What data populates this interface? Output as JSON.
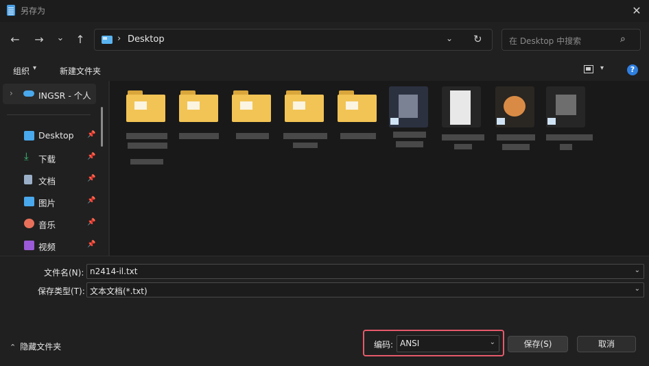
{
  "window": {
    "title": "另存为",
    "close_glyph": "✕"
  },
  "nav": {
    "back": "←",
    "forward": "→",
    "recent": "⌄",
    "up": "↑"
  },
  "address": {
    "chevron": "›",
    "path": "Desktop",
    "dropdown": "⌄",
    "refresh": "↻"
  },
  "search": {
    "placeholder": "在 Desktop 中搜索",
    "icon": "⌕"
  },
  "toolbar": {
    "organize": "组织",
    "organize_chev": "▾",
    "new_folder": "新建文件夹",
    "view_chev": "▾",
    "help": "?"
  },
  "sidebar": {
    "cloud": {
      "label": "INGSR - 个人",
      "chevron": "›"
    },
    "items": [
      {
        "label": "Desktop",
        "icon": "desktop-icon",
        "color": "#4aa8ec"
      },
      {
        "label": "下载",
        "icon": "download-icon",
        "color": "#3cc47c"
      },
      {
        "label": "文档",
        "icon": "documents-icon",
        "color": "#9bb0c8"
      },
      {
        "label": "图片",
        "icon": "pictures-icon",
        "color": "#4aa8ec"
      },
      {
        "label": "音乐",
        "icon": "music-icon",
        "color": "#e8705a"
      },
      {
        "label": "视频",
        "icon": "videos-icon",
        "color": "#9b5ad8"
      }
    ],
    "pin_glyph": "📌"
  },
  "files": [
    {
      "kind": "folder",
      "name": ""
    },
    {
      "kind": "folder",
      "name": ""
    },
    {
      "kind": "folder",
      "name": ""
    },
    {
      "kind": "folder",
      "name": ""
    },
    {
      "kind": "folder",
      "name": ""
    },
    {
      "kind": "shortcut",
      "name": ""
    },
    {
      "kind": "document",
      "name": ""
    },
    {
      "kind": "shortcut",
      "name": ""
    },
    {
      "kind": "shortcut",
      "name": ""
    }
  ],
  "form": {
    "filename_label": "文件名(N):",
    "filename_value": "n2414-il.txt",
    "filetype_label": "保存类型(T):",
    "filetype_value": "文本文档(*.txt)",
    "combo_chev": "⌄"
  },
  "footer": {
    "hide_folders": "隐藏文件夹",
    "hide_chev": "⌃",
    "encoding_label": "编码:",
    "encoding_value": "ANSI",
    "save": "保存(S)",
    "cancel": "取消"
  },
  "colors": {
    "accent": "#2f7fe0",
    "highlight_border": "#e75a6b",
    "folder": "#f2c455"
  }
}
